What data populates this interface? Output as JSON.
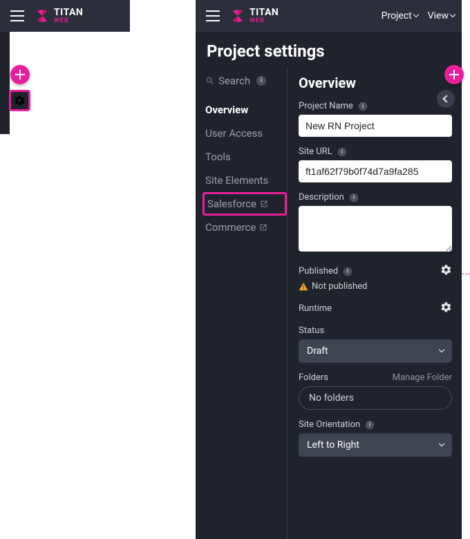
{
  "brand": {
    "name": "TITAN",
    "sub": "WEB"
  },
  "topbar": {
    "menus": {
      "project": "Project",
      "view": "View"
    }
  },
  "page_title": "Project settings",
  "search": {
    "placeholder": "Search"
  },
  "nav": {
    "overview": "Overview",
    "user_access": "User Access",
    "tools": "Tools",
    "site_elements": "Site Elements",
    "salesforce": "Salesforce",
    "commerce": "Commerce"
  },
  "overview": {
    "heading": "Overview",
    "project_name_label": "Project Name",
    "project_name_value": "New RN Project",
    "site_url_label": "Site URL",
    "site_url_value": "ft1af62f79b0f74d7a9fa285",
    "description_label": "Description",
    "description_value": "",
    "published_label": "Published",
    "published_status": "Not published",
    "runtime_label": "Runtime",
    "status_label": "Status",
    "status_value": "Draft",
    "folders_label": "Folders",
    "manage_folder": "Manage Folder",
    "no_folders": "No folders",
    "site_orientation_label": "Site Orientation",
    "site_orientation_value": "Left to Right"
  },
  "colors": {
    "accent": "#e91e9c"
  }
}
